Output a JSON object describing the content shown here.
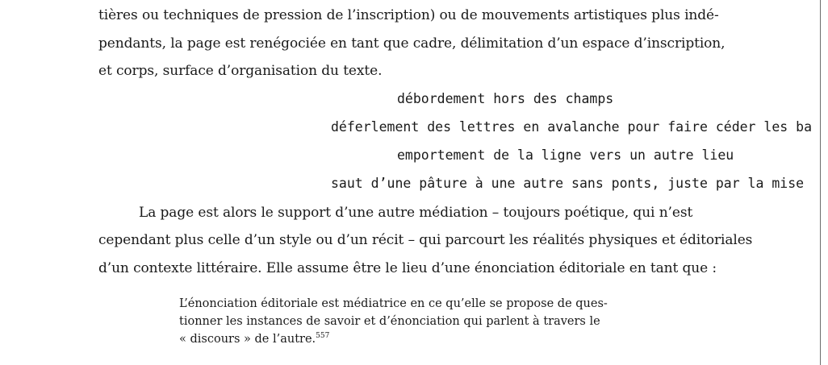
{
  "paragraph_top": {
    "lines": [
      "tières ou techniques de pression de l’inscription) ou de mouvements artistiques plus indé-",
      "pendants, la page est renégociée en tant que cadre, délimitation d’un espace d’inscription,",
      "et corps, surface d’organisation du texte."
    ]
  },
  "poem": {
    "lines": [
      "débordement hors des champs",
      "déferlement des lettres en avalanche pour faire céder les ba",
      "emportement de la ligne vers un autre lieu",
      "saut d’une pâture à une autre sans ponts, juste par la mise"
    ]
  },
  "paragraph_main": {
    "lines": [
      "La page est alors le support d’une autre médiation – toujours poétique, qui n’est",
      "cependant plus celle d’un style ou d’un récit – qui parcourt les réalités physiques et éditoriales",
      "d’un contexte littéraire. Elle assume être le lieu d’une énonciation éditoriale en tant que :"
    ]
  },
  "block_quote": {
    "lines": [
      "L’énonciation éditoriale est médiatrice en ce qu’elle se propose de ques-",
      "tionner les instances de savoir et d’énonciation qui parlent à travers le",
      "« discours » de l’autre."
    ],
    "footnote_ref": "557"
  }
}
